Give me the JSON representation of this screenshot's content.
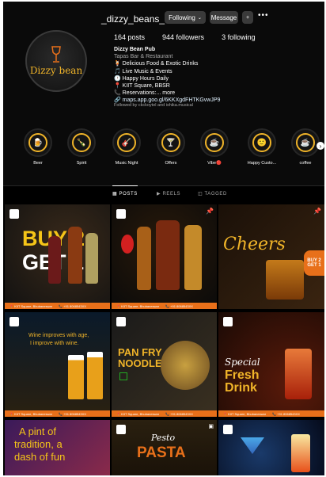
{
  "profile": {
    "username": "_dizzy_beans_",
    "following_label": "Following",
    "message_label": "Message",
    "avatar_text": "Dizzy bean",
    "stats": {
      "posts": "164 posts",
      "followers": "944 followers",
      "following": "3 following"
    },
    "bio": {
      "name": "Dizzy Bean Pub",
      "category": "Tapas Bar & Restaurant",
      "lines": [
        "🍹 Delicious Food & Exotic Drinks",
        "🎵 Live Music & Events",
        "🕐 Happy Hours Daily",
        "📍 KIIT Square, BBSR"
      ],
      "more": "📞 Reservations:... more",
      "link": "🔗 maps.app.goo.gl/6KKXgdFHTKGvwJP9"
    },
    "followed_by": "Followed by ckckoytel and ishika.musical"
  },
  "highlights": [
    {
      "label": "Beer",
      "icon": "beer-icon",
      "glyph": "🍺"
    },
    {
      "label": "Spirit",
      "icon": "bottle-icon",
      "glyph": "🍾"
    },
    {
      "label": "Music Night",
      "icon": "music-icon",
      "glyph": "🎸"
    },
    {
      "label": "Offers",
      "icon": "offer-icon",
      "glyph": "🍸"
    },
    {
      "label": "Vibe🔴",
      "icon": "vibe-icon",
      "glyph": "☕"
    },
    {
      "label": "Happy Custo...",
      "icon": "smile-icon",
      "glyph": "🙂"
    },
    {
      "label": "coffee",
      "icon": "coffee-icon",
      "glyph": "☕"
    }
  ],
  "tabs": [
    "POSTS",
    "REELS",
    "TAGGED"
  ],
  "posts": {
    "p1": {
      "l1": "BUY 2",
      "l2": "GET 1"
    },
    "p3": {
      "title": "Cheers",
      "side": "BUY 2 GET 1"
    },
    "p4": {
      "l1": "Wine improves with age,",
      "l2": "I improve with wine."
    },
    "p5": {
      "l1": "PAN FRY",
      "l2": "NOODLE"
    },
    "p6": {
      "l1": "Special",
      "l2": "Fresh",
      "l3": "Drink"
    },
    "p7": {
      "l1": "A pint of",
      "l2": "tradition, a",
      "l3": "dash of fun"
    },
    "p8": {
      "l1": "Pesto",
      "l2": "PASTA"
    },
    "footer_addr": "📍 KIIT Square, Bhubaneswar",
    "footer_phone": "📞 +91 8068543XX"
  },
  "colors": {
    "accent": "#f0b429",
    "brand_orange": "#e8701a",
    "button": "#3a3a3a"
  }
}
